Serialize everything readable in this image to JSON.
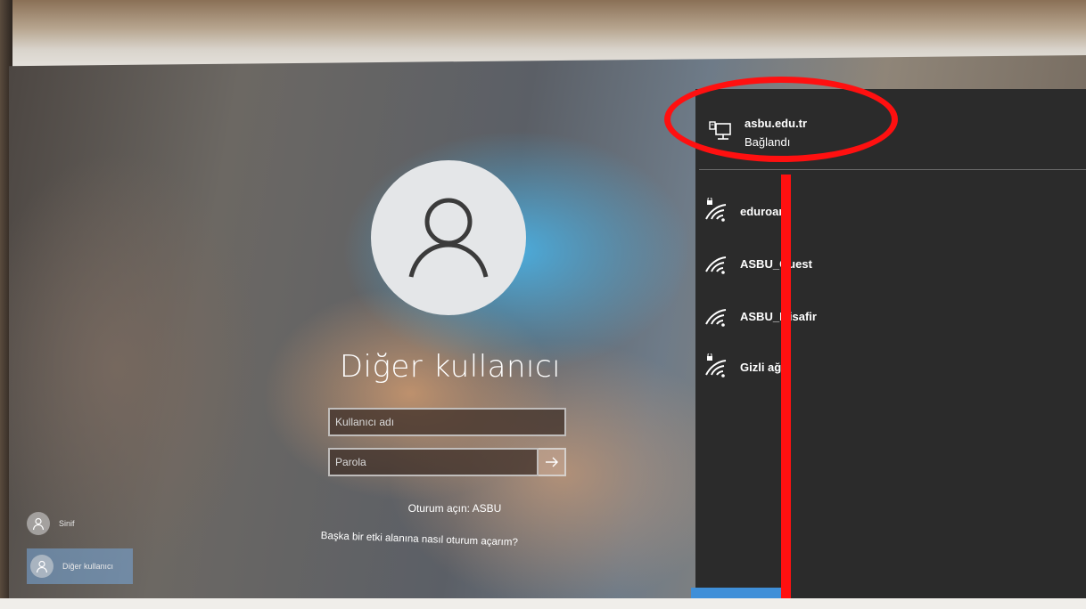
{
  "login": {
    "user_title": "Diğer kullanıcı",
    "username_placeholder": "Kullanıcı adı",
    "password_placeholder": "Parola",
    "signin_domain": "Oturum açın: ASBU",
    "other_domain_link": "Başka bir etki alanına nasıl oturum açarım?",
    "submit_icon": "arrow-right-icon"
  },
  "users": [
    {
      "name": "Sinif",
      "icon": "user-icon"
    },
    {
      "name": "Diğer kullanıcı",
      "icon": "user-icon",
      "selected": true
    }
  ],
  "network": {
    "connected": {
      "name": "asbu.edu.tr",
      "status": "Bağlandı",
      "icon": "ethernet-icon"
    },
    "wifi_networks": [
      {
        "name": "eduroam",
        "secured": true,
        "icon": "wifi-icon"
      },
      {
        "name": "ASBU_Guest",
        "secured": false,
        "icon": "wifi-icon"
      },
      {
        "name": "ASBU_Misafir",
        "secured": false,
        "icon": "wifi-icon"
      },
      {
        "name": "Gizli ağ",
        "secured": true,
        "icon": "wifi-icon"
      }
    ]
  },
  "colors": {
    "annotation": "#ff1010",
    "flyout_background": "#2b2b2b",
    "accent_blue": "#3f8fd8"
  }
}
